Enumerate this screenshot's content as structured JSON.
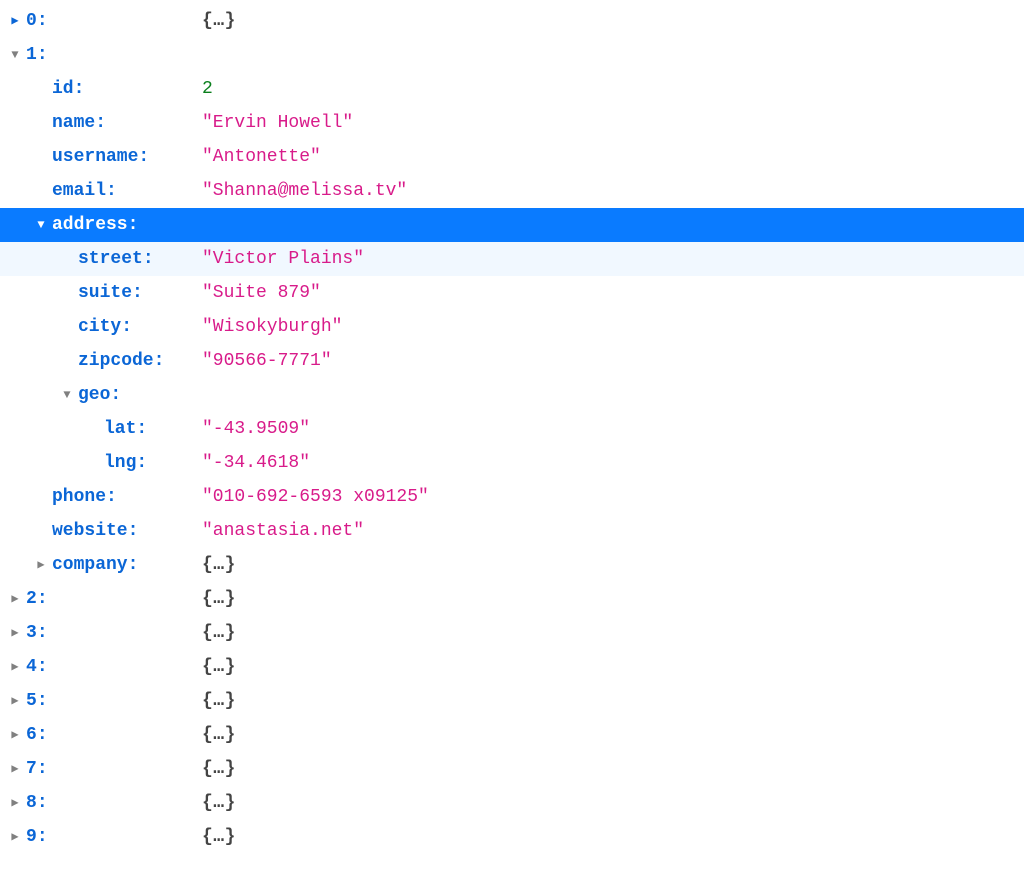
{
  "collapsed_placeholder": "{…}",
  "rows": [
    {
      "indent": 0,
      "arrow": "right",
      "arrowColor": "blue",
      "key": "0",
      "valueType": "obj"
    },
    {
      "indent": 0,
      "arrow": "down",
      "arrowColor": "gray",
      "key": "1",
      "valueType": "none"
    },
    {
      "indent": 1,
      "arrow": "",
      "key": "id",
      "valueType": "num",
      "value": "2"
    },
    {
      "indent": 1,
      "arrow": "",
      "key": "name",
      "valueType": "str",
      "value": "\"Ervin Howell\""
    },
    {
      "indent": 1,
      "arrow": "",
      "key": "username",
      "valueType": "str",
      "value": "\"Antonette\""
    },
    {
      "indent": 1,
      "arrow": "",
      "key": "email",
      "valueType": "str",
      "value": "\"Shanna@melissa.tv\""
    },
    {
      "indent": 1,
      "arrow": "down",
      "arrowColor": "white",
      "key": "address",
      "valueType": "none",
      "selected": true
    },
    {
      "indent": 2,
      "arrow": "",
      "key": "street",
      "valueType": "str",
      "value": "\"Victor Plains\"",
      "hover": true
    },
    {
      "indent": 2,
      "arrow": "",
      "key": "suite",
      "valueType": "str",
      "value": "\"Suite 879\""
    },
    {
      "indent": 2,
      "arrow": "",
      "key": "city",
      "valueType": "str",
      "value": "\"Wisokyburgh\""
    },
    {
      "indent": 2,
      "arrow": "",
      "key": "zipcode",
      "valueType": "str",
      "value": "\"90566-7771\""
    },
    {
      "indent": 2,
      "arrow": "down",
      "arrowColor": "gray",
      "key": "geo",
      "valueType": "none"
    },
    {
      "indent": 3,
      "arrow": "",
      "key": "lat",
      "valueType": "str",
      "value": "\"-43.9509\""
    },
    {
      "indent": 3,
      "arrow": "",
      "key": "lng",
      "valueType": "str",
      "value": "\"-34.4618\""
    },
    {
      "indent": 1,
      "arrow": "",
      "key": "phone",
      "valueType": "str",
      "value": "\"010-692-6593 x09125\""
    },
    {
      "indent": 1,
      "arrow": "",
      "key": "website",
      "valueType": "str",
      "value": "\"anastasia.net\""
    },
    {
      "indent": 1,
      "arrow": "right",
      "arrowColor": "gray",
      "key": "company",
      "valueType": "obj"
    },
    {
      "indent": 0,
      "arrow": "right",
      "arrowColor": "gray",
      "key": "2",
      "valueType": "obj"
    },
    {
      "indent": 0,
      "arrow": "right",
      "arrowColor": "gray",
      "key": "3",
      "valueType": "obj"
    },
    {
      "indent": 0,
      "arrow": "right",
      "arrowColor": "gray",
      "key": "4",
      "valueType": "obj"
    },
    {
      "indent": 0,
      "arrow": "right",
      "arrowColor": "gray",
      "key": "5",
      "valueType": "obj"
    },
    {
      "indent": 0,
      "arrow": "right",
      "arrowColor": "gray",
      "key": "6",
      "valueType": "obj"
    },
    {
      "indent": 0,
      "arrow": "right",
      "arrowColor": "gray",
      "key": "7",
      "valueType": "obj"
    },
    {
      "indent": 0,
      "arrow": "right",
      "arrowColor": "gray",
      "key": "8",
      "valueType": "obj"
    },
    {
      "indent": 0,
      "arrow": "right",
      "arrowColor": "gray",
      "key": "9",
      "valueType": "obj"
    }
  ]
}
